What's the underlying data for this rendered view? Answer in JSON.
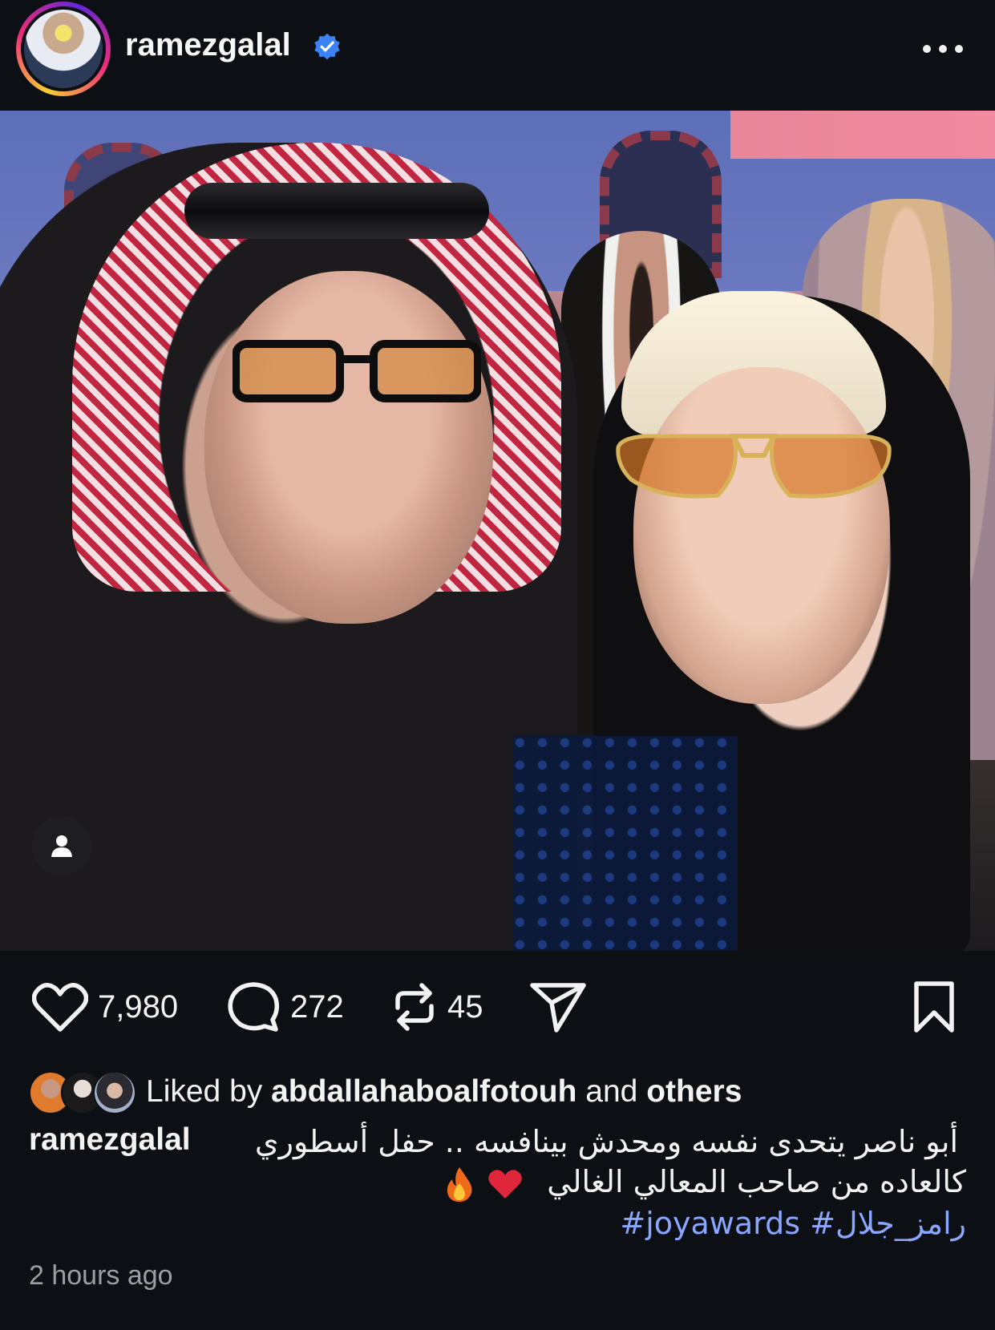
{
  "post": {
    "username": "ramezgalal",
    "verified": true
  },
  "actions": {
    "likes": "7,980",
    "comments": "272",
    "reposts": "45"
  },
  "liked_by": {
    "prefix": "Liked by",
    "user": "abdallahaboalfotouh",
    "middle": "and",
    "others": "others"
  },
  "caption": {
    "username": "ramezgalal",
    "line1": "أبو ناصر يتحدى نفسه ومحدش بينافسه .. حفل أسطوري",
    "line2": "كالعاده من صاحب المعالي الغالي",
    "emojis": [
      "❤️",
      "🔥"
    ],
    "hashtag1": "#رامز_جلال",
    "hashtag2": "#joyawards"
  },
  "timestamp": "2 hours ago",
  "icons": {
    "like": "heart-icon",
    "comment": "comment-bubble-icon",
    "repost": "repost-icon",
    "share": "send-icon",
    "save": "bookmark-icon",
    "more": "more-dots-icon",
    "verified": "verified-badge-icon",
    "tag": "person-tag-icon"
  },
  "colors": {
    "background": "#0c0f14",
    "verified": "#3b82f6",
    "hashtag": "#8aa6ff",
    "heart_emoji": "#e0263a"
  }
}
